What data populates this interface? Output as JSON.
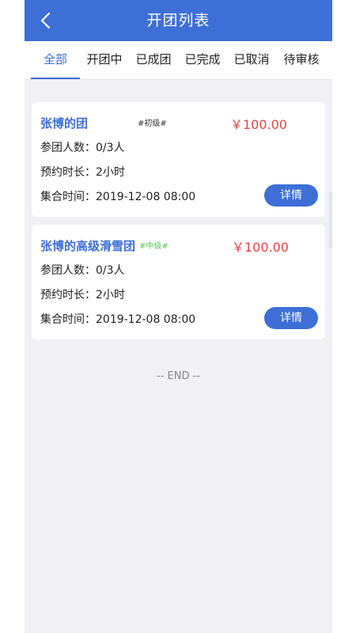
{
  "header": {
    "title": "开团列表",
    "back_icon": "chevron-left-icon"
  },
  "tabs": [
    {
      "label": "全部",
      "active": true
    },
    {
      "label": "开团中",
      "active": false
    },
    {
      "label": "已成团",
      "active": false
    },
    {
      "label": "已完成",
      "active": false
    },
    {
      "label": "已取消",
      "active": false
    },
    {
      "label": "待审核",
      "active": false
    }
  ],
  "cards": [
    {
      "title": "张博的团",
      "level": "#初级#",
      "price": "￥100.00",
      "members": "参团人数：0/3人",
      "duration": "预约时长：2小时",
      "meet_time": "集合时间：2019-12-08 08:00",
      "detail_label": "详情"
    },
    {
      "title": "张博的高级滑雪团",
      "level": "#中级#",
      "price": "￥100.00",
      "members": "参团人数：0/3人",
      "duration": "预约时长：2小时",
      "meet_time": "集合时间：2019-12-08 08:00",
      "detail_label": "详情"
    }
  ],
  "footer": {
    "end_text": "-- END --"
  },
  "colors": {
    "primary": "#3d6fd6",
    "price": "#e54343",
    "level_beginner": "#333333",
    "level_intermediate": "#5cc55c",
    "background": "#f0f0f5"
  }
}
